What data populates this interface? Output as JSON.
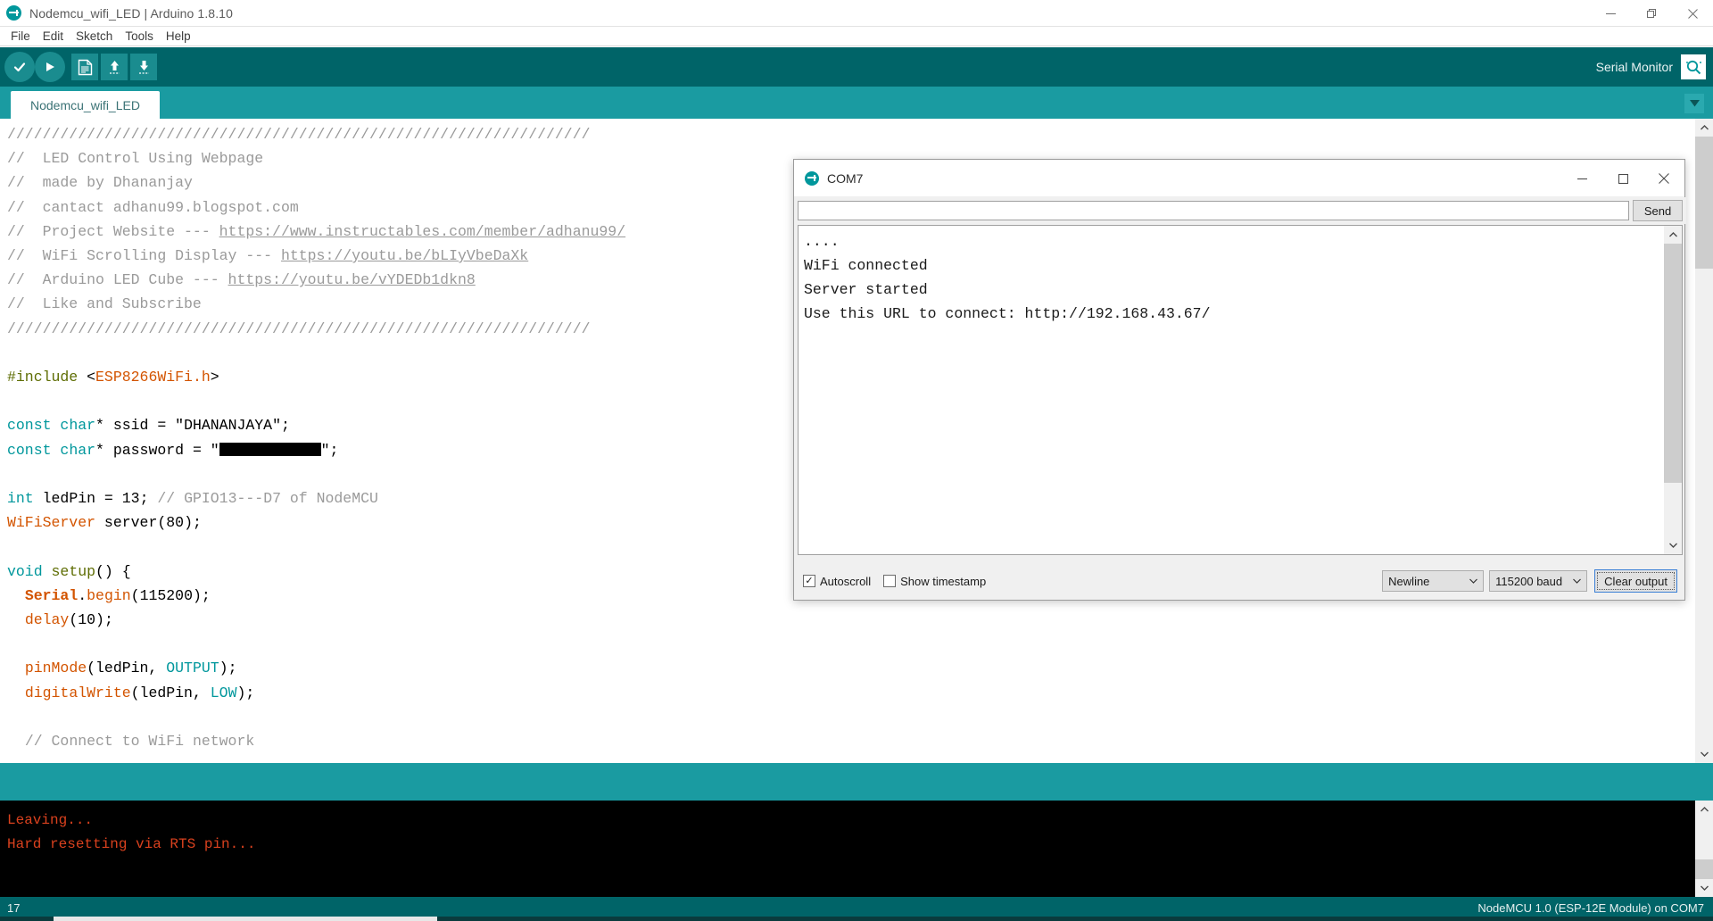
{
  "window": {
    "title": "Nodemcu_wifi_LED | Arduino 1.8.10",
    "minimize": "—",
    "maximize": "❐",
    "close": "✕"
  },
  "menu": {
    "items": [
      "File",
      "Edit",
      "Sketch",
      "Tools",
      "Help"
    ]
  },
  "toolbar": {
    "verify_tooltip": "Verify",
    "upload_tooltip": "Upload",
    "new_tooltip": "New",
    "open_tooltip": "Open",
    "save_tooltip": "Save",
    "serial_monitor_label": "Serial Monitor"
  },
  "tabs": {
    "active": "Nodemcu_wifi_LED",
    "menu_caret": "▼"
  },
  "editor": {
    "lines": [
      "//////////////////////////////////////////////////////////////////",
      "//  LED Control Using Webpage",
      "//  made by Dhananjay",
      "//  cantact adhanu99.blogspot.com",
      "//  Project Website --- https://www.instructables.com/member/adhanu99/",
      "//  WiFi Scrolling Display --- https://youtu.be/bLIyVbeDaXk",
      "//  Arduino LED Cube --- https://youtu.be/vYDEDb1dkn8",
      "//  Like and Subscribe",
      "//////////////////////////////////////////////////////////////////",
      "",
      "#include <ESP8266WiFi.h>",
      "",
      "const char* ssid = \"DHANANJAYA\";",
      "const char* password = \"██████████\";",
      "",
      "int ledPin = 13; // GPIO13---D7 of NodeMCU",
      "WiFiServer server(80);",
      "",
      "void setup() {",
      "  Serial.begin(115200);",
      "  delay(10);",
      "",
      "  pinMode(ledPin, OUTPUT);",
      "  digitalWrite(ledPin, LOW);",
      "",
      "  // Connect to WiFi network"
    ],
    "links": [
      "https://www.instructables.com/member/adhanu99/",
      "https://youtu.be/bLIyVbeDaXk",
      "https://youtu.be/vYDEDb1dkn8"
    ],
    "ssid_value": "DHANANJAYA",
    "include_lib": "ESP8266WiFi.h",
    "led_pin": "13",
    "server_port": "80",
    "baud_in_code": "115200",
    "delay_ms": "10"
  },
  "console": {
    "lines": [
      "Leaving...",
      "Hard resetting via RTS pin..."
    ]
  },
  "statusbar": {
    "line_number": "17",
    "board_info": "NodeMCU 1.0 (ESP-12E Module) on COM7"
  },
  "serial_monitor": {
    "title": "COM7",
    "input_value": "",
    "input_placeholder": "",
    "send_label": "Send",
    "output_lines": [
      "....",
      "WiFi connected",
      "Server started",
      "Use this URL to connect: http://192.168.43.67/"
    ],
    "autoscroll_label": "Autoscroll",
    "autoscroll_checked": "✓",
    "timestamp_label": "Show timestamp",
    "line_ending": "Newline",
    "baud_rate": "115200 baud",
    "clear_label": "Clear output",
    "minimize": "—",
    "maximize": "❐",
    "close": "✕",
    "caret": "⌄"
  },
  "colors": {
    "toolbar_bg": "#006468",
    "tabbar_bg": "#1a9ba1",
    "accent": "#00979c",
    "console_text": "#d9411e",
    "keyword": "#00979c",
    "function": "#d35400",
    "comment": "#9a9a9a"
  }
}
